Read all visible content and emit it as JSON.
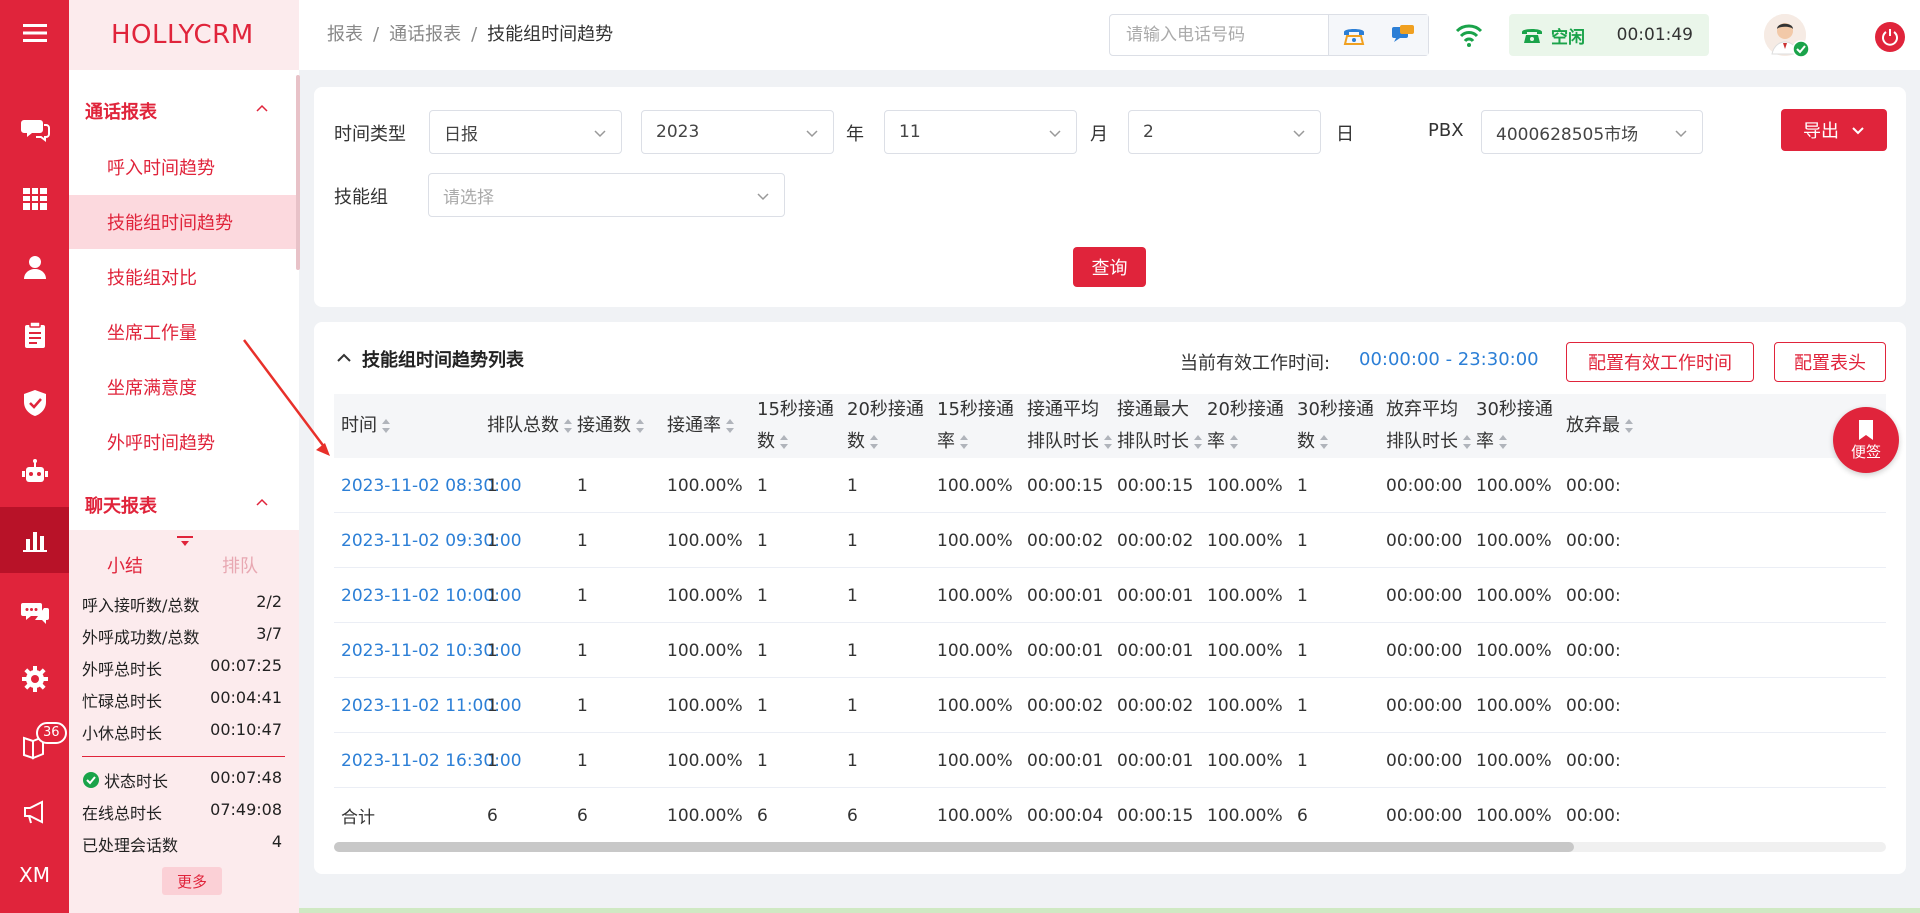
{
  "app": {
    "brand": "HOLLYCRM"
  },
  "rail": {
    "xm_label": "XM",
    "badge_count": "36"
  },
  "breadcrumb": {
    "items": [
      "报表",
      "通话报表",
      "技能组时间趋势"
    ],
    "separator": "/"
  },
  "topbar": {
    "phone_placeholder": "请输入电话号码",
    "status_label": "空闲",
    "status_timer": "00:01:49"
  },
  "sidebar": {
    "section1": "通话报表",
    "items": [
      "呼入时间趋势",
      "技能组时间趋势",
      "技能组对比",
      "坐席工作量",
      "坐席满意度",
      "外呼时间趋势"
    ],
    "section2": "聊天报表"
  },
  "stats": {
    "tab_summary": "小结",
    "tab_queue": "排队",
    "rows": [
      {
        "label": "呼入接听数/总数",
        "value": "2/2"
      },
      {
        "label": "外呼成功数/总数",
        "value": "3/7"
      },
      {
        "label": "外呼总时长",
        "value": "00:07:25"
      },
      {
        "label": "忙碌总时长",
        "value": "00:04:41"
      },
      {
        "label": "小休总时长",
        "value": "00:10:47"
      }
    ],
    "rows2": [
      {
        "label": "状态时长",
        "value": "00:07:48"
      },
      {
        "label": "在线总时长",
        "value": "07:49:08"
      },
      {
        "label": "已处理会话数",
        "value": "4"
      }
    ],
    "more": "更多"
  },
  "filter": {
    "time_type_label": "时间类型",
    "time_type_value": "日报",
    "year_value": "2023",
    "year_unit": "年",
    "month_value": "11",
    "month_unit": "月",
    "day_value": "2",
    "day_unit": "日",
    "pbx_label": "PBX",
    "pbx_value": "4000628505市场",
    "skill_label": "技能组",
    "skill_placeholder": "请选择",
    "export": "导出",
    "query": "查询"
  },
  "table": {
    "title": "技能组时间趋势列表",
    "effective_label": "当前有效工作时间:",
    "effective_value": "00:00:00 - 23:30:00",
    "config_time_btn": "配置有效工作时间",
    "config_header_btn": "配置表头",
    "columns": [
      [
        "时间"
      ],
      [
        "排队总数"
      ],
      [
        "接通数"
      ],
      [
        "接通率"
      ],
      [
        "15秒接通",
        "数"
      ],
      [
        "20秒接通",
        "数"
      ],
      [
        "15秒接通",
        "率"
      ],
      [
        "接通平均",
        "排队时长"
      ],
      [
        "接通最大",
        "排队时长"
      ],
      [
        "20秒接通",
        "率"
      ],
      [
        "30秒接通",
        "数"
      ],
      [
        "放弃平均",
        "排队时长"
      ],
      [
        "30秒接通",
        "率"
      ],
      [
        "放弃最",
        ""
      ]
    ],
    "rows": [
      [
        "2023-11-02 08:30:00",
        "1",
        "1",
        "100.00%",
        "1",
        "1",
        "100.00%",
        "00:00:15",
        "00:00:15",
        "100.00%",
        "1",
        "00:00:00",
        "100.00%",
        "00:00:"
      ],
      [
        "2023-11-02 09:30:00",
        "1",
        "1",
        "100.00%",
        "1",
        "1",
        "100.00%",
        "00:00:02",
        "00:00:02",
        "100.00%",
        "1",
        "00:00:00",
        "100.00%",
        "00:00:"
      ],
      [
        "2023-11-02 10:00:00",
        "1",
        "1",
        "100.00%",
        "1",
        "1",
        "100.00%",
        "00:00:01",
        "00:00:01",
        "100.00%",
        "1",
        "00:00:00",
        "100.00%",
        "00:00:"
      ],
      [
        "2023-11-02 10:30:00",
        "1",
        "1",
        "100.00%",
        "1",
        "1",
        "100.00%",
        "00:00:01",
        "00:00:01",
        "100.00%",
        "1",
        "00:00:00",
        "100.00%",
        "00:00:"
      ],
      [
        "2023-11-02 11:00:00",
        "1",
        "1",
        "100.00%",
        "1",
        "1",
        "100.00%",
        "00:00:02",
        "00:00:02",
        "100.00%",
        "1",
        "00:00:00",
        "100.00%",
        "00:00:"
      ],
      [
        "2023-11-02 16:30:00",
        "1",
        "1",
        "100.00%",
        "1",
        "1",
        "100.00%",
        "00:00:01",
        "00:00:01",
        "100.00%",
        "1",
        "00:00:00",
        "100.00%",
        "00:00:"
      ],
      [
        "合计",
        "6",
        "6",
        "100.00%",
        "6",
        "6",
        "100.00%",
        "00:00:04",
        "00:00:15",
        "100.00%",
        "6",
        "00:00:00",
        "100.00%",
        "00:00:"
      ]
    ]
  },
  "float_button": {
    "label": "便签"
  },
  "colors": {
    "primary": "#e0243b",
    "link": "#2c7fd6",
    "success": "#1aa34a"
  }
}
